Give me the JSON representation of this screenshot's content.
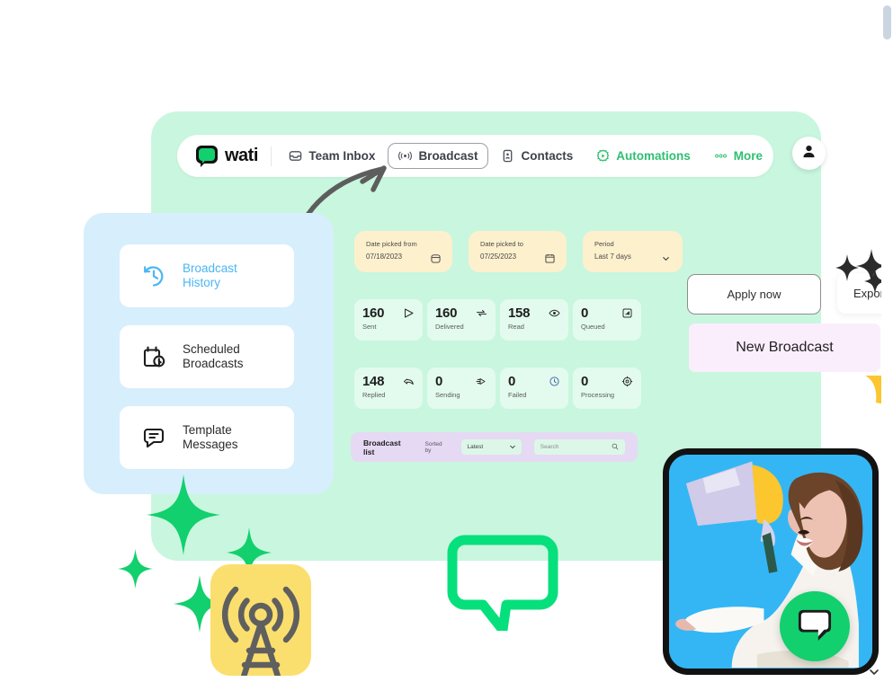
{
  "brand": {
    "name": "wati",
    "logo_icon": "wati-chat-logo",
    "accent": "#12d06d"
  },
  "nav": {
    "separator": true,
    "items": [
      {
        "label": "Team Inbox",
        "icon": "inbox-icon",
        "active": false,
        "accent": false
      },
      {
        "label": "Broadcast",
        "icon": "broadcast-icon",
        "active": true,
        "accent": false
      },
      {
        "label": "Contacts",
        "icon": "contacts-icon",
        "active": false,
        "accent": false
      },
      {
        "label": "Automations",
        "icon": "automations-icon",
        "active": false,
        "accent": true
      },
      {
        "label": "More",
        "icon": "more-dots-icon",
        "active": false,
        "accent": true
      }
    ],
    "avatar_icon": "user-avatar-icon"
  },
  "sidebar": {
    "background": "#d7eefc",
    "items": [
      {
        "label_line1": "Broadcast",
        "label_line2": "History",
        "icon": "history-clock-icon",
        "active": true
      },
      {
        "label_line1": "Scheduled",
        "label_line2": "Broadcasts",
        "icon": "calendar-clock-icon",
        "active": false
      },
      {
        "label_line1": "Template",
        "label_line2": "Messages",
        "icon": "message-lines-icon",
        "active": false
      }
    ],
    "active_color": "#4ab6f5"
  },
  "filters": {
    "background": "#fdf0cd",
    "fields": [
      {
        "label": "Date picked from",
        "value": "07/18/2023",
        "icon": "calendar-icon"
      },
      {
        "label": "Date picked to",
        "value": "07/25/2023",
        "icon": "calendar-icon"
      },
      {
        "label": "Period",
        "value": "Last 7 days",
        "icon": "chevron-down-icon"
      }
    ]
  },
  "stats": {
    "background": "#e2fbee",
    "cards": [
      {
        "value": "160",
        "label": "Sent",
        "icon": "send-icon"
      },
      {
        "value": "160",
        "label": "Delivered",
        "icon": "delivered-icon"
      },
      {
        "value": "158",
        "label": "Read",
        "icon": "eye-icon"
      },
      {
        "value": "0",
        "label": "Queued",
        "icon": "queue-icon"
      },
      {
        "value": "148",
        "label": "Replied",
        "icon": "reply-icon"
      },
      {
        "value": "0",
        "label": "Sending",
        "icon": "sending-icon"
      },
      {
        "value": "0",
        "label": "Failed",
        "icon": "failed-clock-icon"
      },
      {
        "value": "0",
        "label": "Processing",
        "icon": "processing-icon"
      }
    ]
  },
  "list_bar": {
    "background": "#e6d9f4",
    "title": "Broadcast list",
    "sorted_by_label": "Sorted by",
    "sort_value": "Latest",
    "sort_icon": "chevron-down-icon",
    "search_placeholder": "Search",
    "search_icon": "search-icon"
  },
  "actions": {
    "apply_label": "Apply now",
    "export_label": "Export",
    "new_broadcast_label": "New Broadcast",
    "new_broadcast_bg": "#fbeefc"
  },
  "decor": {
    "tower_icon": "broadcast-tower-icon",
    "tower_tile_bg": "#fbdf6e",
    "bubble_icon": "speech-bubble-icon",
    "sparkle_icon": "sparkle-icon",
    "sparkle_color": "#12d06d",
    "arrow_icon": "curved-arrow-icon",
    "photo_alt": "woman-with-megaphone-photo",
    "phone_bg": "#34b6f5",
    "fab_icon": "chat-bubble-icon"
  },
  "scrollbar": {
    "position": "right",
    "chevron_icon": "chevron-down-icon"
  }
}
